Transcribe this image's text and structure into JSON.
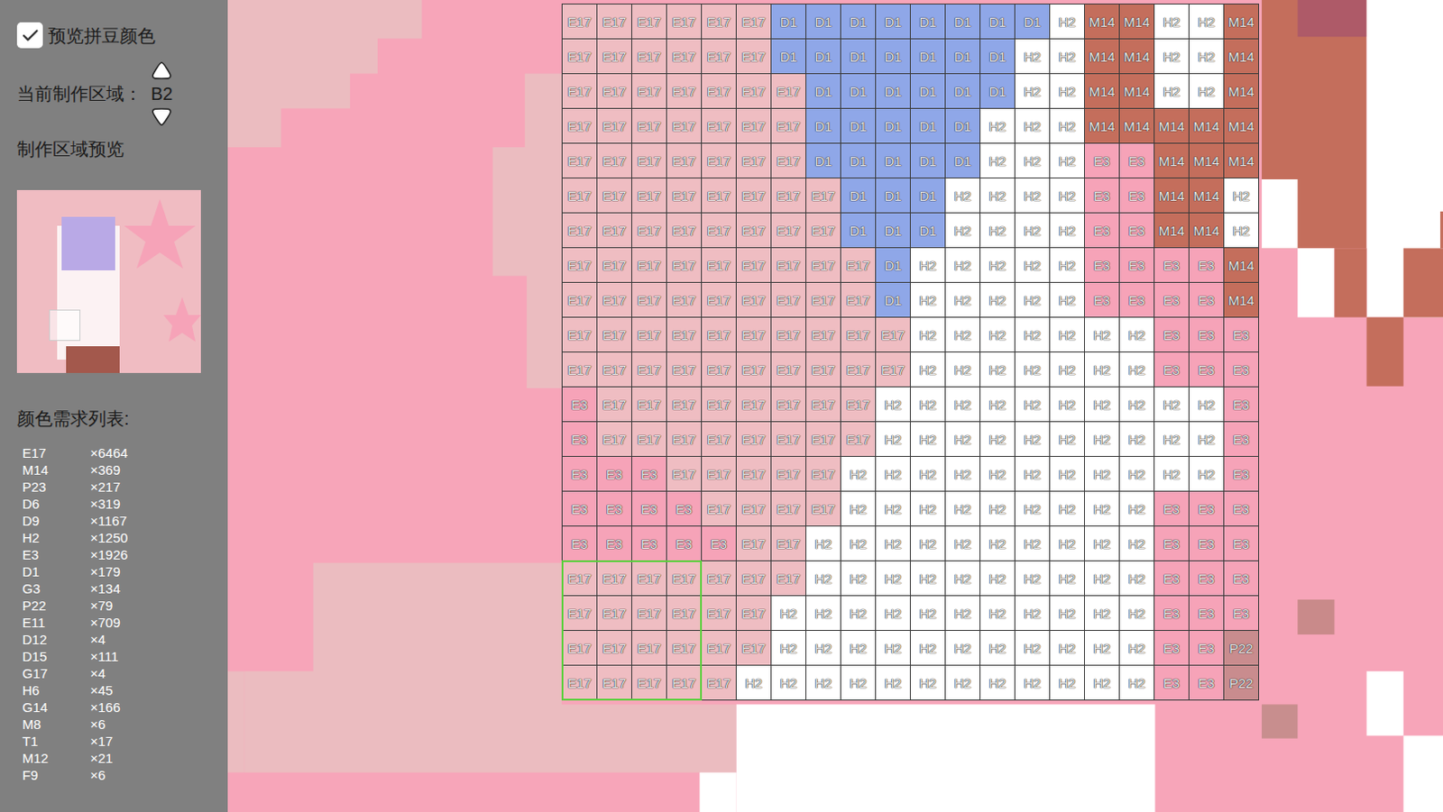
{
  "sidebar": {
    "preview_toggle": {
      "label": "预览拼豆颜色",
      "checked": true
    },
    "region": {
      "label": "当前制作区域：",
      "value": "B2"
    },
    "preview_title": "制作区域预览",
    "color_list_title": "颜色需求列表:",
    "color_list": [
      {
        "code": "E17",
        "count": "×6464"
      },
      {
        "code": "M14",
        "count": "×369"
      },
      {
        "code": "P23",
        "count": "×217"
      },
      {
        "code": "D6",
        "count": "×319"
      },
      {
        "code": "D9",
        "count": "×1167"
      },
      {
        "code": "H2",
        "count": "×1250"
      },
      {
        "code": "E3",
        "count": "×1926"
      },
      {
        "code": "D1",
        "count": "×179"
      },
      {
        "code": "G3",
        "count": "×134"
      },
      {
        "code": "P22",
        "count": "×79"
      },
      {
        "code": "E11",
        "count": "×709"
      },
      {
        "code": "D12",
        "count": "×4"
      },
      {
        "code": "D15",
        "count": "×111"
      },
      {
        "code": "G17",
        "count": "×4"
      },
      {
        "code": "H6",
        "count": "×45"
      },
      {
        "code": "G14",
        "count": "×166"
      },
      {
        "code": "M8",
        "count": "×6"
      },
      {
        "code": "T1",
        "count": "×17"
      },
      {
        "code": "M12",
        "count": "×21"
      },
      {
        "code": "F9",
        "count": "×6"
      }
    ]
  },
  "grid": {
    "palette": [
      {
        "code": "E17",
        "color": "#efbdc2"
      },
      {
        "code": "D1",
        "color": "#8fa7e8"
      },
      {
        "code": "H2",
        "color": "#ffffff"
      },
      {
        "code": "M14",
        "color": "#c46e5c"
      },
      {
        "code": "E3",
        "color": "#f6a3b8"
      },
      {
        "code": "P22",
        "color": "#c98c8e"
      }
    ],
    "highlight": {
      "first_row": 16,
      "last_row": 19,
      "first_col": 0,
      "last_col": 3
    },
    "rows": [
      [
        "E17",
        "E17",
        "E17",
        "E17",
        "E17",
        "E17",
        "D1",
        "D1",
        "D1",
        "D1",
        "D1",
        "D1",
        "D1",
        "D1",
        "H2",
        "M14",
        "M14",
        "H2",
        "H2",
        "M14"
      ],
      [
        "E17",
        "E17",
        "E17",
        "E17",
        "E17",
        "E17",
        "D1",
        "D1",
        "D1",
        "D1",
        "D1",
        "D1",
        "D1",
        "H2",
        "H2",
        "M14",
        "M14",
        "H2",
        "H2",
        "M14"
      ],
      [
        "E17",
        "E17",
        "E17",
        "E17",
        "E17",
        "E17",
        "E17",
        "D1",
        "D1",
        "D1",
        "D1",
        "D1",
        "D1",
        "H2",
        "H2",
        "M14",
        "M14",
        "H2",
        "H2",
        "M14"
      ],
      [
        "E17",
        "E17",
        "E17",
        "E17",
        "E17",
        "E17",
        "E17",
        "D1",
        "D1",
        "D1",
        "D1",
        "D1",
        "H2",
        "H2",
        "H2",
        "M14",
        "M14",
        "M14",
        "M14",
        "M14"
      ],
      [
        "E17",
        "E17",
        "E17",
        "E17",
        "E17",
        "E17",
        "E17",
        "D1",
        "D1",
        "D1",
        "D1",
        "D1",
        "H2",
        "H2",
        "H2",
        "E3",
        "E3",
        "M14",
        "M14",
        "M14"
      ],
      [
        "E17",
        "E17",
        "E17",
        "E17",
        "E17",
        "E17",
        "E17",
        "E17",
        "D1",
        "D1",
        "D1",
        "H2",
        "H2",
        "H2",
        "H2",
        "E3",
        "E3",
        "M14",
        "M14",
        "H2"
      ],
      [
        "E17",
        "E17",
        "E17",
        "E17",
        "E17",
        "E17",
        "E17",
        "E17",
        "D1",
        "D1",
        "D1",
        "H2",
        "H2",
        "H2",
        "H2",
        "E3",
        "E3",
        "M14",
        "M14",
        "H2"
      ],
      [
        "E17",
        "E17",
        "E17",
        "E17",
        "E17",
        "E17",
        "E17",
        "E17",
        "E17",
        "D1",
        "H2",
        "H2",
        "H2",
        "H2",
        "H2",
        "E3",
        "E3",
        "E3",
        "E3",
        "M14"
      ],
      [
        "E17",
        "E17",
        "E17",
        "E17",
        "E17",
        "E17",
        "E17",
        "E17",
        "E17",
        "D1",
        "H2",
        "H2",
        "H2",
        "H2",
        "H2",
        "E3",
        "E3",
        "E3",
        "E3",
        "M14"
      ],
      [
        "E17",
        "E17",
        "E17",
        "E17",
        "E17",
        "E17",
        "E17",
        "E17",
        "E17",
        "E17",
        "H2",
        "H2",
        "H2",
        "H2",
        "H2",
        "H2",
        "H2",
        "E3",
        "E3",
        "E3"
      ],
      [
        "E17",
        "E17",
        "E17",
        "E17",
        "E17",
        "E17",
        "E17",
        "E17",
        "E17",
        "E17",
        "H2",
        "H2",
        "H2",
        "H2",
        "H2",
        "H2",
        "H2",
        "E3",
        "E3",
        "E3"
      ],
      [
        "E3",
        "E17",
        "E17",
        "E17",
        "E17",
        "E17",
        "E17",
        "E17",
        "E17",
        "H2",
        "H2",
        "H2",
        "H2",
        "H2",
        "H2",
        "H2",
        "H2",
        "H2",
        "H2",
        "E3"
      ],
      [
        "E3",
        "E17",
        "E17",
        "E17",
        "E17",
        "E17",
        "E17",
        "E17",
        "E17",
        "H2",
        "H2",
        "H2",
        "H2",
        "H2",
        "H2",
        "H2",
        "H2",
        "H2",
        "H2",
        "E3"
      ],
      [
        "E3",
        "E3",
        "E3",
        "E17",
        "E17",
        "E17",
        "E17",
        "E17",
        "H2",
        "H2",
        "H2",
        "H2",
        "H2",
        "H2",
        "H2",
        "H2",
        "H2",
        "H2",
        "H2",
        "E3"
      ],
      [
        "E3",
        "E3",
        "E3",
        "E3",
        "E17",
        "E17",
        "E17",
        "E17",
        "H2",
        "H2",
        "H2",
        "H2",
        "H2",
        "H2",
        "H2",
        "H2",
        "H2",
        "E3",
        "E3",
        "E3"
      ],
      [
        "E3",
        "E3",
        "E3",
        "E3",
        "E3",
        "E17",
        "E17",
        "H2",
        "H2",
        "H2",
        "H2",
        "H2",
        "H2",
        "H2",
        "H2",
        "H2",
        "H2",
        "E3",
        "E3",
        "E3"
      ],
      [
        "E17",
        "E17",
        "E17",
        "E17",
        "E17",
        "E17",
        "E17",
        "H2",
        "H2",
        "H2",
        "H2",
        "H2",
        "H2",
        "H2",
        "H2",
        "H2",
        "H2",
        "E3",
        "E3",
        "E3"
      ],
      [
        "E17",
        "E17",
        "E17",
        "E17",
        "E17",
        "E17",
        "H2",
        "H2",
        "H2",
        "H2",
        "H2",
        "H2",
        "H2",
        "H2",
        "H2",
        "H2",
        "H2",
        "E3",
        "E3",
        "E3"
      ],
      [
        "E17",
        "E17",
        "E17",
        "E17",
        "E17",
        "E17",
        "H2",
        "H2",
        "H2",
        "H2",
        "H2",
        "H2",
        "H2",
        "H2",
        "H2",
        "H2",
        "H2",
        "E3",
        "E3",
        "P22"
      ],
      [
        "E17",
        "E17",
        "E17",
        "E17",
        "E17",
        "H2",
        "H2",
        "H2",
        "H2",
        "H2",
        "H2",
        "H2",
        "H2",
        "H2",
        "H2",
        "H2",
        "H2",
        "E3",
        "E3",
        "P22"
      ]
    ]
  }
}
